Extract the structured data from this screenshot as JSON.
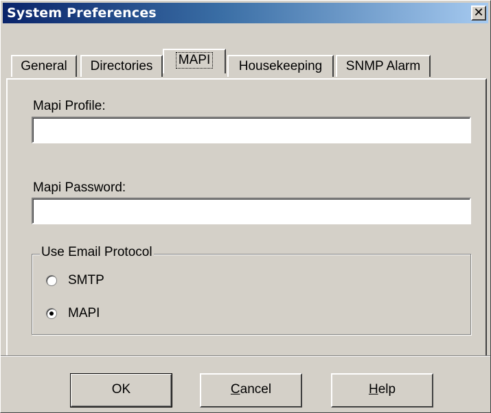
{
  "window": {
    "title": "System Preferences",
    "close_glyph": "✕"
  },
  "tabs": [
    {
      "label": "General",
      "active": false
    },
    {
      "label": "Directories",
      "active": false
    },
    {
      "label": "MAPI",
      "active": true
    },
    {
      "label": "Housekeeping",
      "active": false
    },
    {
      "label": "SNMP Alarm",
      "active": false
    }
  ],
  "form": {
    "mapi_profile_label": "Mapi Profile:",
    "mapi_profile_value": "",
    "mapi_password_label": "Mapi Password:",
    "mapi_password_value": "",
    "protocol_group_label": "Use Email Protocol",
    "options": [
      {
        "label": "SMTP",
        "selected": false
      },
      {
        "label": "MAPI",
        "selected": true
      }
    ]
  },
  "buttons": {
    "ok": "OK",
    "cancel_first": "C",
    "cancel_rest": "ancel",
    "help_first": "H",
    "help_rest": "elp"
  },
  "colors": {
    "face": "#d4d0c8",
    "title_start": "#0a246a",
    "title_end": "#a6caf0"
  }
}
